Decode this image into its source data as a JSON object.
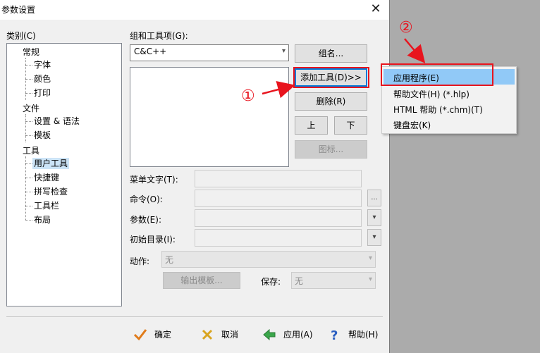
{
  "dialog": {
    "title": "参数设置",
    "category_label": "类别(C)",
    "tree": {
      "groups": [
        {
          "label": "常规",
          "children": [
            "字体",
            "颜色",
            "打印"
          ]
        },
        {
          "label": "文件",
          "children": [
            "设置 & 语法",
            "模板"
          ]
        },
        {
          "label": "工具",
          "children": [
            "用户工具",
            "快捷键",
            "拼写检查",
            "工具栏",
            "布局"
          ]
        }
      ],
      "selected": "用户工具"
    },
    "group_label": "组和工具项(G):",
    "group_value": "C&C++",
    "buttons": {
      "group_name": "组名...",
      "add_tool": "添加工具(D)>>",
      "delete": "删除(R)",
      "up": "上",
      "down": "下",
      "icon": "图标..."
    },
    "fields": {
      "menu_text": "菜单文字(T):",
      "command": "命令(O):",
      "command_browse": "...",
      "args": "参数(E):",
      "init_dir": "初始目录(I):"
    },
    "action_label": "动作:",
    "action_value": "无",
    "output_template": "输出模板...",
    "save_label": "保存:",
    "save_value": "无",
    "bottom": {
      "ok": "确定",
      "cancel": "取消",
      "apply": "应用(A)",
      "help": "帮助(H)"
    }
  },
  "popup_menu": {
    "items": [
      "应用程序(E)",
      "帮助文件(H) (*.hlp)",
      "HTML 帮助 (*.chm)(T)",
      "键盘宏(K)"
    ],
    "highlighted": "应用程序(E)"
  },
  "annotations": {
    "step1": "①",
    "step2": "②",
    "color": "#e8141e"
  }
}
